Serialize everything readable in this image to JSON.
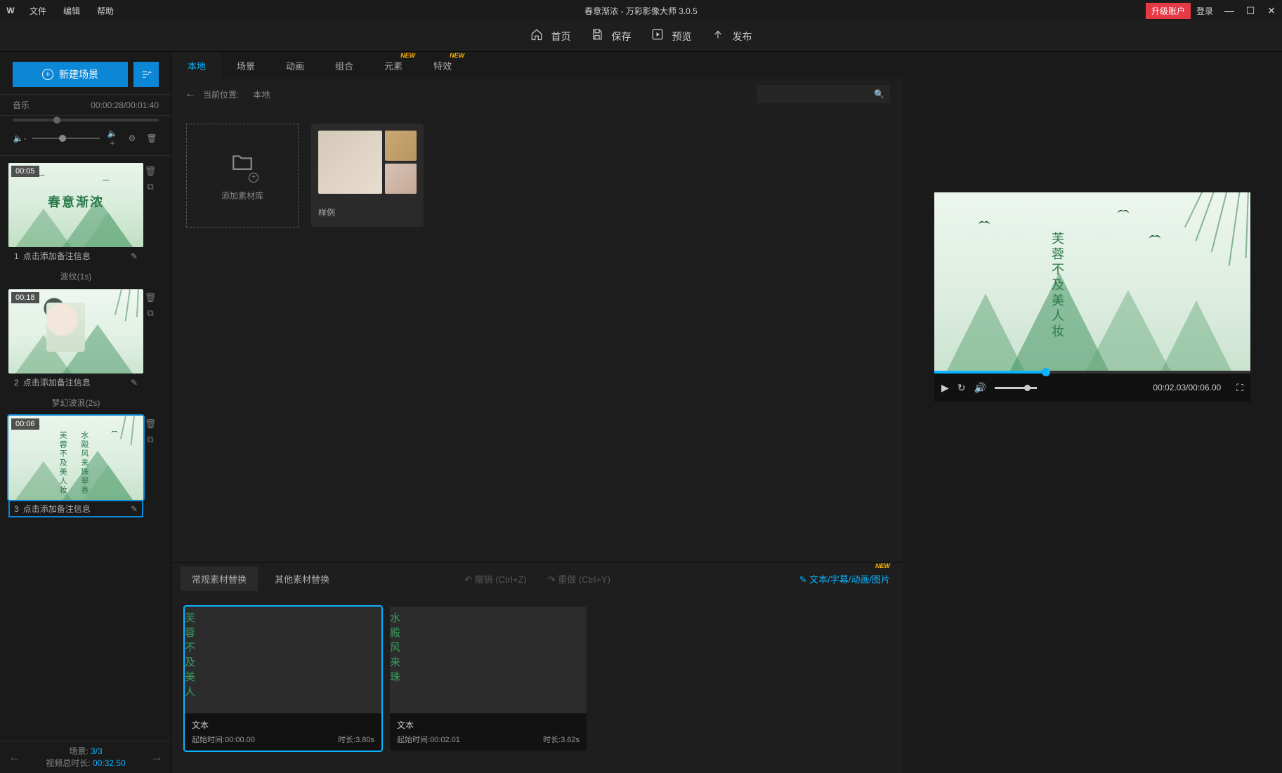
{
  "titlebar": {
    "menus": {
      "file": "文件",
      "edit": "编辑",
      "help": "帮助"
    },
    "title": "春意渐浓 - 万彩影像大师 3.0.5",
    "upgrade": "升级账户",
    "login": "登录"
  },
  "toolbar": {
    "home": "首页",
    "save": "保存",
    "preview": "预览",
    "publish": "发布"
  },
  "sidebar": {
    "new_scene": "新建场景",
    "music_label": "音乐",
    "music_time": "00:00:28/00:01:40",
    "scenes": [
      {
        "idx": "1",
        "ts": "00:05",
        "caption": "点击添加备注信息"
      },
      {
        "idx": "2",
        "ts": "00:18",
        "caption": "点击添加备注信息"
      },
      {
        "idx": "3",
        "ts": "00:06",
        "caption": "点击添加备注信息"
      }
    ],
    "transitions": [
      "波纹(1s)",
      "梦幻波浪(2s)"
    ],
    "scene1_title": "春意渐浓",
    "scene3_text_a": "芙蓉不及美人妆",
    "scene3_text_b": "水殿风来珠翠香",
    "footer": {
      "scene_label": "场景:",
      "scene_val": "3/3",
      "total_label": "视频总时长:",
      "total_val": "00:32.50"
    }
  },
  "center": {
    "tabs": {
      "local": "本地",
      "scene": "场景",
      "anim": "动画",
      "combo": "组合",
      "element": "元素",
      "effect": "特效",
      "new_badge": "NEW"
    },
    "breadcrumb_label": "当前位置:",
    "breadcrumb_val": "本地",
    "add_asset": "添加素材库",
    "sample_folder": "样例"
  },
  "bottom": {
    "tab_normal": "常规素材替换",
    "tab_other": "其他素材替换",
    "undo": "撤销 (Ctrl+Z)",
    "redo": "重做 (Ctrl+Y)",
    "edit_link": "文本/字幕/动画/图片",
    "new_badge": "NEW",
    "clips": [
      {
        "text_col": "芙蓉不及美人",
        "type": "文本",
        "start_label": "起始时间:",
        "start": "00:00.00",
        "dur_label": "时长:",
        "dur": "3.80s"
      },
      {
        "text_col": "水殿风来珠",
        "type": "文本",
        "start_label": "起始时间:",
        "start": "00:02.01",
        "dur_label": "时长:",
        "dur": "3.62s"
      }
    ]
  },
  "preview": {
    "time": "00:02.03/00:06.00",
    "vtext": "芙蓉不及美人妆"
  }
}
